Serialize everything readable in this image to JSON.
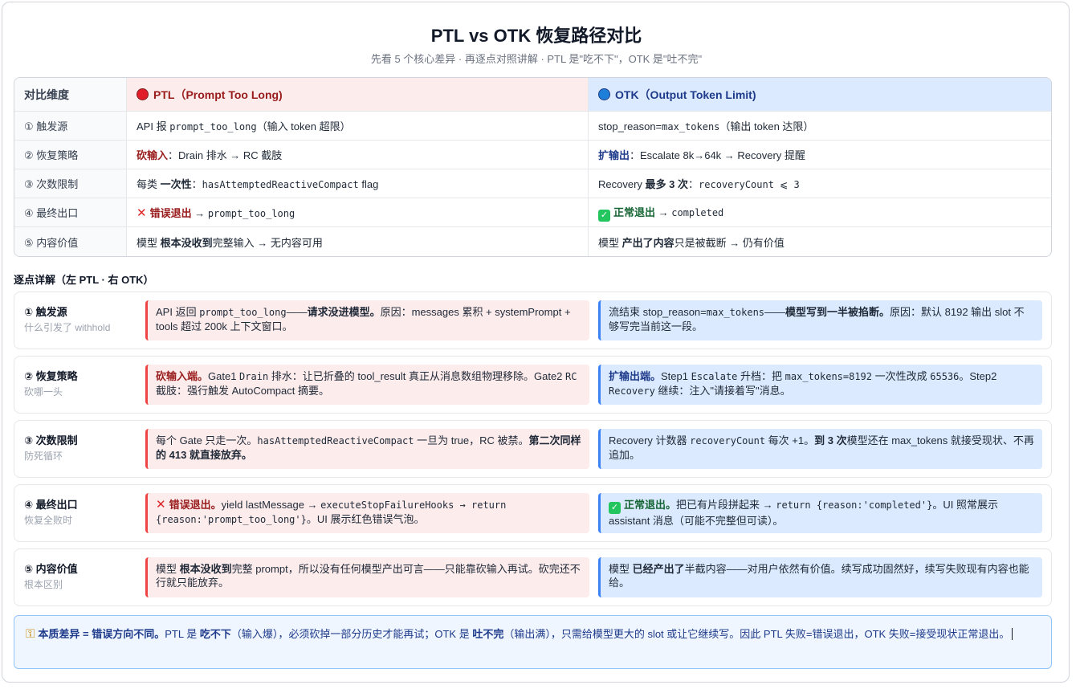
{
  "header": {
    "title": "PTL vs OTK 恢复路径对比",
    "subtitle": "先看 5 个核心差异 · 再逐点对照讲解 · PTL 是\"吃不下\"，OTK 是\"吐不完\""
  },
  "table": {
    "head": {
      "dim": "对比维度",
      "ptl": "PTL（Prompt Too Long)",
      "otk": "OTK（Output Token Limit)"
    },
    "rows": [
      {
        "dim": "① 触发源",
        "ptl": {
          "a": "API 报 ",
          "code": "prompt_too_long",
          "b": "（输入 token 超限）"
        },
        "otk": {
          "a": "stop_reason=",
          "code": "max_tokens",
          "b": "（输出 token 达限）"
        }
      },
      {
        "dim": "② 恢复策略",
        "ptl": {
          "strong": "砍输入",
          "rest": "：Drain 排水 → RC 截肢"
        },
        "otk": {
          "strong": "扩输出",
          "rest": "：Escalate 8k→64k → Recovery 提醒"
        }
      },
      {
        "dim": "③ 次数限制",
        "ptl": {
          "a": "每类 ",
          "strong": "一次性",
          "b": "：",
          "code": "hasAttemptedReactiveCompact",
          "c": " flag"
        },
        "otk": {
          "a": "Recovery ",
          "strong": "最多 3 次",
          "b": "：",
          "code": "recoveryCount ⩽ 3"
        }
      },
      {
        "dim": "④ 最终出口",
        "ptl": {
          "strong": "错误退出",
          "arrow": " → ",
          "code": "prompt_too_long"
        },
        "otk": {
          "strong": "正常退出",
          "arrow": " → ",
          "code": "completed"
        }
      },
      {
        "dim": "⑤ 内容价值",
        "ptl": {
          "a": "模型 ",
          "strong": "根本没收到",
          "b": "完整输入 → 无内容可用"
        },
        "otk": {
          "a": "模型 ",
          "strong": "产出了内容",
          "b": "只是被截断 → 仍有价值"
        }
      }
    ]
  },
  "details": {
    "section_title": "逐点详解（左 PTL · 右 OTK）",
    "items": [
      {
        "label": "① 触发源",
        "sub": "什么引发了 withhold",
        "ptl": {
          "a": "API 返回 ",
          "code": "prompt_too_long",
          "b": "——",
          "strong": "请求没进模型。",
          "c": "原因：messages 累积 + systemPrompt + tools 超过 200k 上下文窗口。"
        },
        "otk": {
          "a": "流结束 stop_reason=",
          "code": "max_tokens",
          "b": "——",
          "strong": "模型写到一半被掐断。",
          "c": "原因：默认 8192 输出 slot 不够写完当前这一段。"
        }
      },
      {
        "label": "② 恢复策略",
        "sub": "砍哪一头",
        "ptl": {
          "strong": "砍输入端。",
          "a": "Gate1 ",
          "code": "Drain",
          "b": " 排水：让已折叠的 tool_result 真正从消息数组物理移除。Gate2 ",
          "code2": "RC",
          "c": " 截肢：强行触发 AutoCompact 摘要。"
        },
        "otk": {
          "strong": "扩输出端。",
          "a": "Step1 ",
          "code": "Escalate",
          "b": " 升档：把 ",
          "code2": "max_tokens=8192",
          "c": " 一次性改成 ",
          "code3": "65536",
          "d": "。Step2 ",
          "code4": "Recovery",
          "e": " 继续：注入\"请接着写\"消息。"
        }
      },
      {
        "label": "③ 次数限制",
        "sub": "防死循环",
        "ptl": {
          "a": "每个 Gate 只走一次。",
          "code": "hasAttemptedReactiveCompact",
          "b": " 一旦为 true，RC 被禁。",
          "strong": "第二次同样的 413 就直接放弃。"
        },
        "otk": {
          "a": "Recovery 计数器 ",
          "code": "recoveryCount",
          "b": " 每次 +1。",
          "strong": "到 3 次",
          "c": "模型还在 max_tokens 就接受现状、不再追加。"
        }
      },
      {
        "label": "④ 最终出口",
        "sub": "恢复全败时",
        "ptl": {
          "strong": "错误退出。",
          "a": "yield lastMessage → ",
          "code": "executeStopFailureHooks → return {reason:'prompt_too_long'}",
          "b": "。UI 展示红色错误气泡。"
        },
        "otk": {
          "strong": "正常退出。",
          "a": "把已有片段拼起来 → ",
          "code": "return {reason:'completed'}",
          "b": "。UI 照常展示 assistant 消息（可能不完整但可读）。"
        }
      },
      {
        "label": "⑤ 内容价值",
        "sub": "根本区别",
        "ptl": {
          "a": "模型 ",
          "strong": "根本没收到",
          "b": "完整 prompt，所以没有任何模型产出可言——只能靠砍输入再试。砍完还不行就只能放弃。"
        },
        "otk": {
          "a": "模型 ",
          "strong": "已经产出了",
          "b": "半截内容——对用户依然有价值。续写成功固然好，续写失败现有内容也能给。"
        }
      }
    ]
  },
  "summary": {
    "strong": "本质差异 = 错误方向不同。",
    "a": "PTL 是 ",
    "s2": "吃不下",
    "b": "（输入爆），必须砍掉一部分历史才能再试；OTK 是 ",
    "s3": "吐不完",
    "c": "（输出满），只需给模型更大的 slot 或让它继续写。因此 PTL 失败=错误退出，OTK 失败=接受现状正常退出。"
  },
  "colors": {
    "ptl_accent": "#ef4444",
    "ptl_bg": "#fdecec",
    "otk_accent": "#3b82f6",
    "otk_bg": "#dbeafe",
    "ok_green": "#22c55e"
  },
  "icons": [
    "red-circle-icon",
    "blue-circle-icon",
    "cross-mark-icon",
    "check-mark-icon",
    "key-icon"
  ]
}
